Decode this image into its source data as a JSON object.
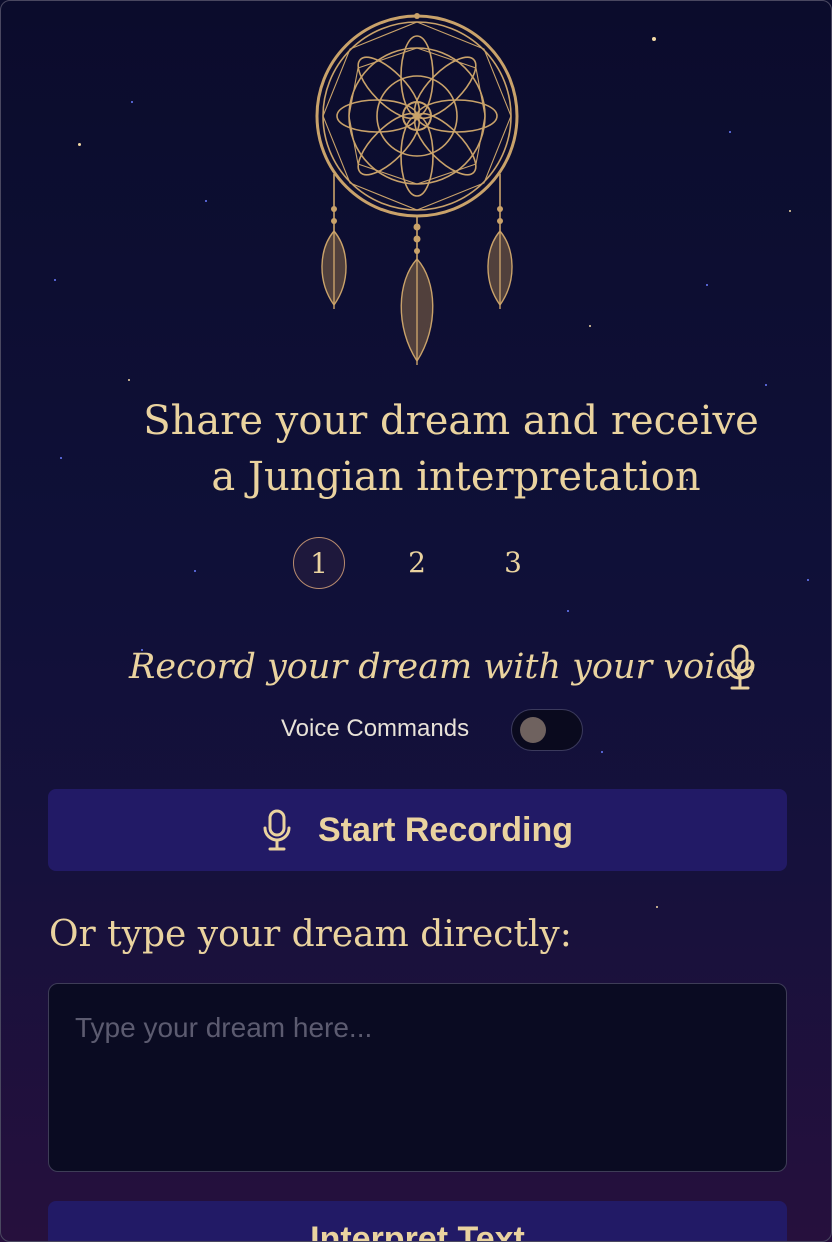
{
  "tagline": {
    "line1": "Share your dream and receive",
    "line2": "a Jungian interpretation"
  },
  "steps": [
    {
      "label": "1",
      "active": true
    },
    {
      "label": "2",
      "active": false
    },
    {
      "label": "3",
      "active": false
    }
  ],
  "voice": {
    "heading": "Record your dream with your voice",
    "commands_label": "Voice Commands",
    "commands_enabled": false
  },
  "record_button": {
    "label": "Start Recording"
  },
  "type_section": {
    "heading": "Or type your dream directly:",
    "placeholder": "Type your dream here...",
    "value": ""
  },
  "interpret_button": {
    "label": "Interpret Text"
  },
  "icons": {
    "dreamcatcher": "dreamcatcher-icon",
    "microphone": "microphone-icon"
  },
  "colors": {
    "gold": "#ead39f",
    "button": "#221a66",
    "background": "#0b0c2c"
  }
}
